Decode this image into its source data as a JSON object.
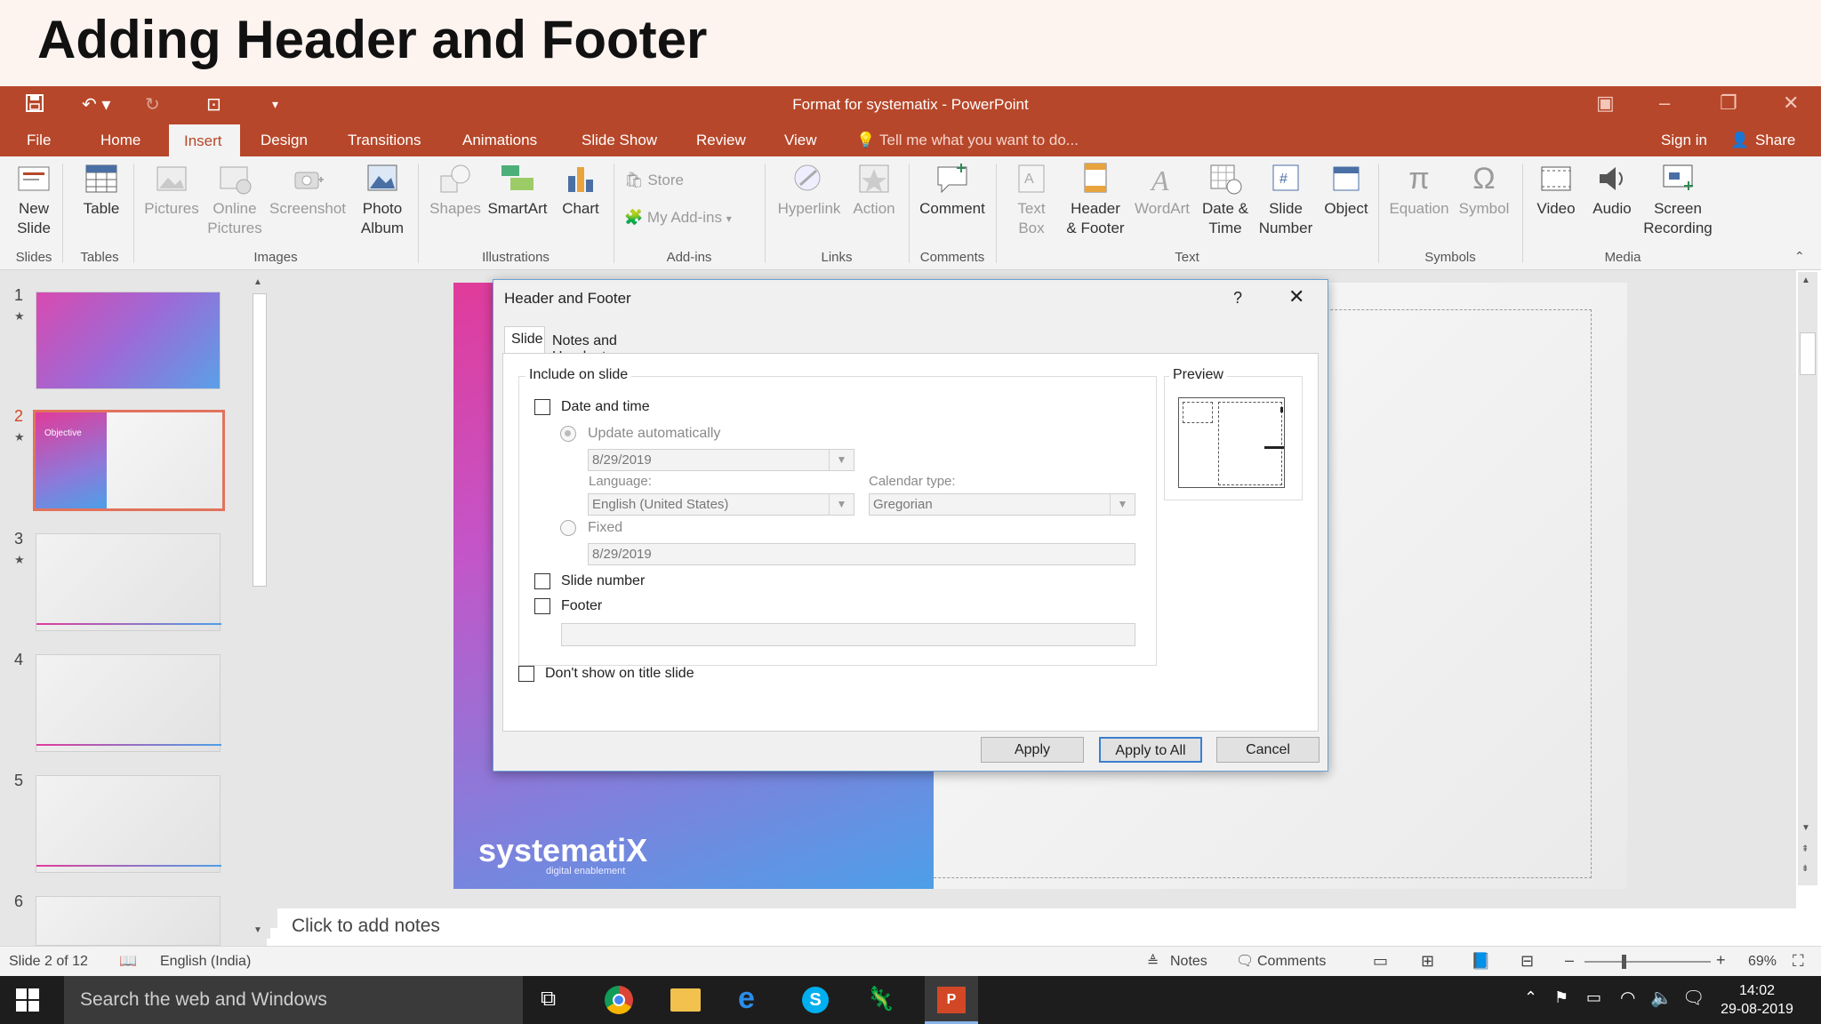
{
  "banner": {
    "title": "Adding Header and Footer"
  },
  "window": {
    "title": "Format for systematix - PowerPoint"
  },
  "menu": {
    "tabs": [
      "File",
      "Home",
      "Insert",
      "Design",
      "Transitions",
      "Animations",
      "Slide Show",
      "Review",
      "View"
    ],
    "active": "Insert",
    "tell_me": "Tell me what you want to do...",
    "sign_in": "Sign in",
    "share": "Share"
  },
  "ribbon": {
    "new_slide": "New\nSlide",
    "table": "Table",
    "pictures": "Pictures",
    "online_pictures": "Online\nPictures",
    "screenshot": "Screenshot",
    "photo_album": "Photo\nAlbum",
    "shapes": "Shapes",
    "smartart": "SmartArt",
    "chart": "Chart",
    "store": "Store",
    "my_addins": "My Add-ins",
    "hyperlink": "Hyperlink",
    "action": "Action",
    "comment": "Comment",
    "text_box": "Text\nBox",
    "header_footer": "Header\n& Footer",
    "wordart": "WordArt",
    "date_time": "Date &\nTime",
    "slide_number": "Slide\nNumber",
    "object": "Object",
    "equation": "Equation",
    "symbol": "Symbol",
    "video": "Video",
    "audio": "Audio",
    "screen_recording": "Screen\nRecording",
    "groups": {
      "slides": "Slides",
      "tables": "Tables",
      "images": "Images",
      "illustrations": "Illustrations",
      "addins": "Add-ins",
      "links": "Links",
      "comments": "Comments",
      "text": "Text",
      "symbols": "Symbols",
      "media": "Media"
    }
  },
  "slides_panel": {
    "numbers": [
      "1",
      "2",
      "3",
      "4",
      "5",
      "6"
    ],
    "slide2_title": "Objective"
  },
  "slide": {
    "logo": "systematiX",
    "tagline": "digital enablement"
  },
  "notes": {
    "placeholder": "Click to add notes"
  },
  "dialog": {
    "title": "Header and Footer",
    "help": "?",
    "tabs": [
      "Slide",
      "Notes and Handouts"
    ],
    "include_label": "Include on slide",
    "date_time": "Date and time",
    "update_auto": "Update automatically",
    "date_value": "8/29/2019",
    "language_label": "Language:",
    "language_value": "English (United States)",
    "calendar_label": "Calendar type:",
    "calendar_value": "Gregorian",
    "fixed": "Fixed",
    "fixed_value": "8/29/2019",
    "slide_number": "Slide number",
    "footer": "Footer",
    "footer_value": "",
    "dont_show": "Don't show on title slide",
    "preview": "Preview",
    "apply": "Apply",
    "apply_all": "Apply to All",
    "cancel": "Cancel"
  },
  "status": {
    "slide_of": "Slide 2 of 12",
    "language": "English (India)",
    "notes": "Notes",
    "comments": "Comments",
    "zoom": "69%"
  },
  "taskbar": {
    "search": "Search the web and Windows",
    "time": "14:02",
    "date": "29-08-2019"
  }
}
